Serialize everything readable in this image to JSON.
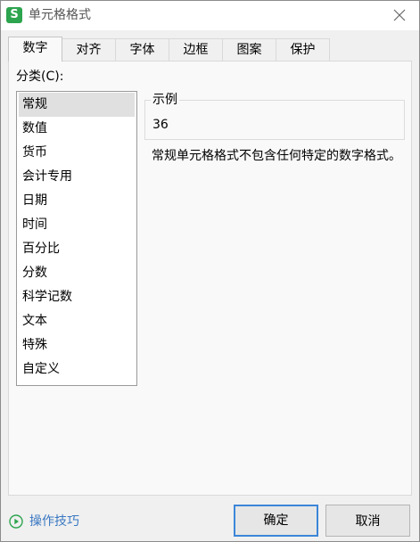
{
  "window": {
    "title": "单元格格式",
    "app_icon_letter": "S"
  },
  "tabs": [
    {
      "label": "数字",
      "active": true
    },
    {
      "label": "对齐",
      "active": false
    },
    {
      "label": "字体",
      "active": false
    },
    {
      "label": "边框",
      "active": false
    },
    {
      "label": "图案",
      "active": false
    },
    {
      "label": "保护",
      "active": false
    }
  ],
  "number_panel": {
    "category_label": "分类(C):",
    "categories": [
      "常规",
      "数值",
      "货币",
      "会计专用",
      "日期",
      "时间",
      "百分比",
      "分数",
      "科学记数",
      "文本",
      "特殊",
      "自定义"
    ],
    "selected_category": "常规",
    "sample_label": "示例",
    "sample_value": "36",
    "description": "常规单元格格式不包含任何特定的数字格式。"
  },
  "footer": {
    "tips_label": "操作技巧",
    "ok_label": "确定",
    "cancel_label": "取消"
  },
  "colors": {
    "accent": "#3c86d8",
    "link": "#3a78c2",
    "app_icon": "#2da44e",
    "selected_item": "#e0e0e0"
  }
}
